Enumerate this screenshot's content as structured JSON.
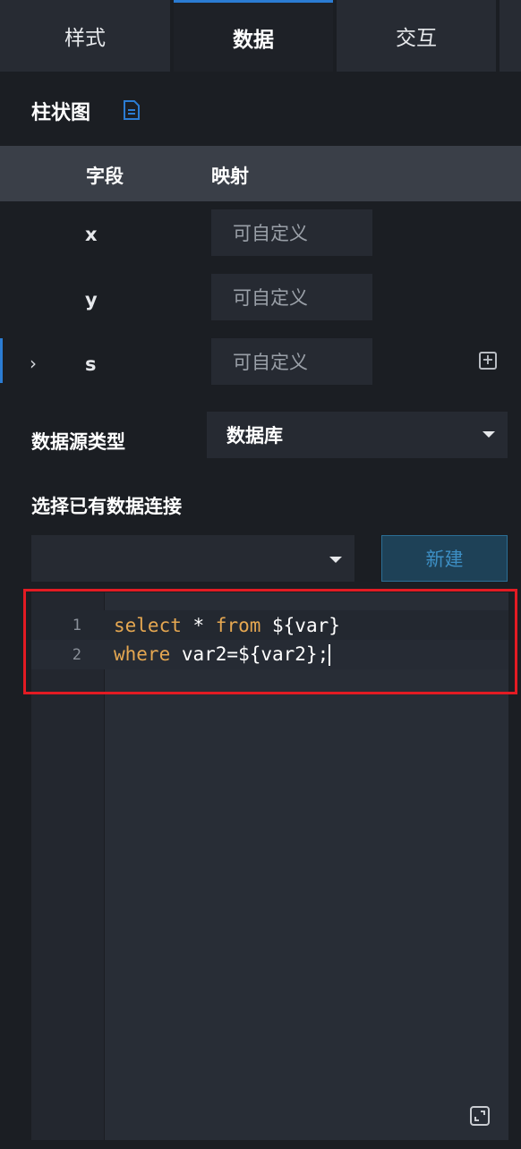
{
  "tabs": [
    {
      "label": "样式",
      "active": false
    },
    {
      "label": "数据",
      "active": true
    },
    {
      "label": "交互",
      "active": false
    }
  ],
  "section": {
    "title": "柱状图",
    "icon": "document-icon"
  },
  "mapping_table": {
    "headers": {
      "field": "字段",
      "mapping": "映射"
    },
    "rows": [
      {
        "field": "x",
        "placeholder": "可自定义"
      },
      {
        "field": "y",
        "placeholder": "可自定义"
      },
      {
        "field": "s",
        "placeholder": "可自定义",
        "expand_icon": "chevron-right-icon",
        "add_icon": "plus-square-icon"
      }
    ]
  },
  "datasource": {
    "type_label": "数据源类型",
    "type_value": "数据库",
    "connection_label": "选择已有数据连接",
    "connection_value": "",
    "new_button": "新建"
  },
  "editor": {
    "lines": [
      {
        "number": "1",
        "tokens": [
          {
            "text": "select",
            "style": "keyword"
          },
          {
            "text": " * ",
            "style": "plain"
          },
          {
            "text": "from",
            "style": "keyword"
          },
          {
            "text": " ${var}",
            "style": "plain"
          }
        ]
      },
      {
        "number": "2",
        "tokens": [
          {
            "text": "where",
            "style": "keyword"
          },
          {
            "text": " var2=${var2};",
            "style": "plain"
          }
        ]
      }
    ],
    "highlight_color": "#e31b23",
    "fullscreen_icon": "expand-icon"
  },
  "colors": {
    "accent": "#2b7cd3",
    "keyword": "#e5a751",
    "panel": "#1b1e23"
  }
}
